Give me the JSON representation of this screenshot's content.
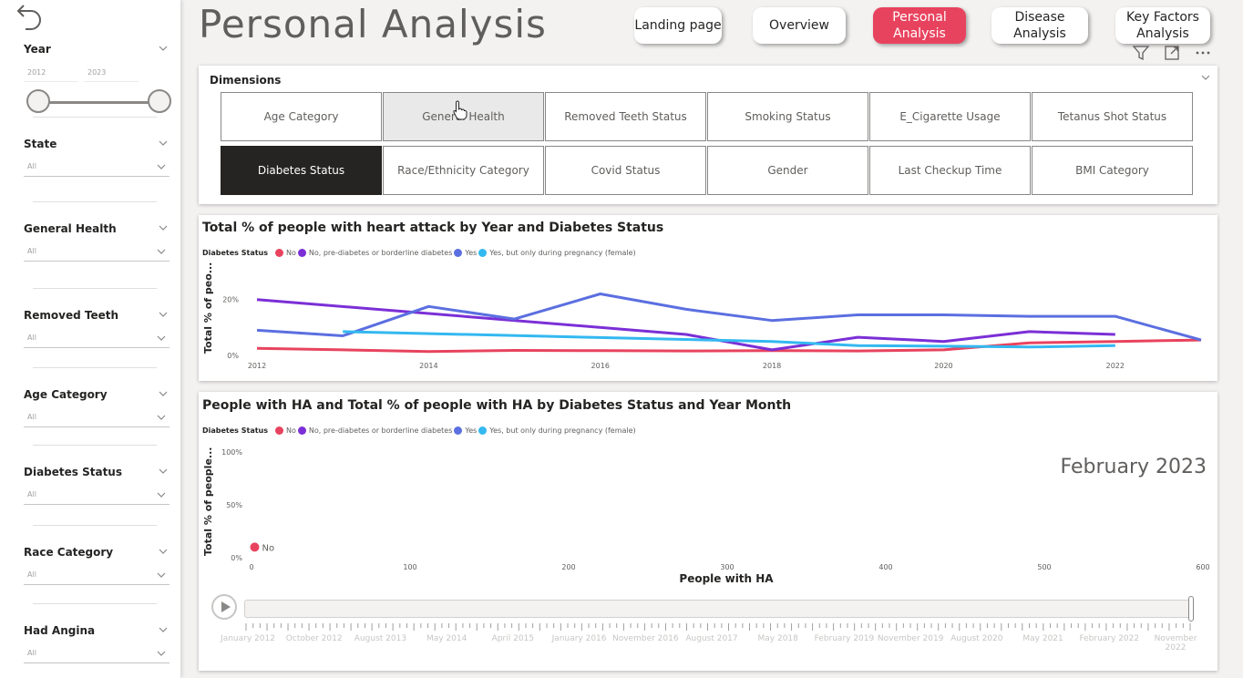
{
  "page": {
    "title": "Personal Analysis"
  },
  "nav": [
    {
      "label": "Landing page",
      "active": false
    },
    {
      "label": "Overview",
      "active": false
    },
    {
      "label": "Personal Analysis",
      "active": true
    },
    {
      "label": "Disease Analysis",
      "active": false
    },
    {
      "label": "Key Factors Analysis",
      "active": false
    }
  ],
  "toolbar_icons": [
    "filter-icon",
    "focus-mode-icon",
    "more-options-icon"
  ],
  "sidebar": {
    "back_icon": "back-arrow-icon",
    "year": {
      "title": "Year",
      "from": "2012",
      "to": "2023"
    },
    "filters": [
      {
        "title": "State",
        "value": "All"
      },
      {
        "title": "General Health",
        "value": "All"
      },
      {
        "title": "Removed Teeth",
        "value": "All"
      },
      {
        "title": "Age Category",
        "value": "All"
      },
      {
        "title": "Diabetes Status",
        "value": "All"
      },
      {
        "title": "Race Category",
        "value": "All"
      },
      {
        "title": "Had Angina",
        "value": "All"
      }
    ]
  },
  "dimensions": {
    "title": "Dimensions",
    "tiles": [
      {
        "label": "Age Category",
        "state": "normal"
      },
      {
        "label": "General Health",
        "state": "hover"
      },
      {
        "label": "Removed Teeth Status",
        "state": "normal"
      },
      {
        "label": "Smoking Status",
        "state": "normal"
      },
      {
        "label": "E_Cigarette Usage",
        "state": "normal"
      },
      {
        "label": "Tetanus Shot Status",
        "state": "normal"
      },
      {
        "label": "Diabetes Status",
        "state": "selected"
      },
      {
        "label": "Race/Ethnicity Category",
        "state": "normal"
      },
      {
        "label": "Covid Status",
        "state": "normal"
      },
      {
        "label": "Gender",
        "state": "normal"
      },
      {
        "label": "Last Checkup Time",
        "state": "normal"
      },
      {
        "label": "BMI Category",
        "state": "normal"
      }
    ]
  },
  "colors": {
    "No": "#e8435e",
    "No, pre-diabetes or borderline diabetes": "#7b2fd6",
    "Yes": "#5b6fe0",
    "Yes, but only during pregnancy (female)": "#33b8f0"
  },
  "chart1": {
    "title": "Total % of people with heart attack by Year and Diabetes Status",
    "legend_title": "Diabetes Status",
    "y_axis_title": "Total % of peo..."
  },
  "chart2": {
    "title": "People with HA and Total % of people with HA by Diabetes Status and Year Month",
    "legend_title": "Diabetes Status",
    "y_axis_title": "Total % of people...",
    "x_axis_title": "People with HA",
    "period_label": "February 2023",
    "point_label": "No"
  },
  "chart_data": [
    {
      "type": "line",
      "title": "Total % of people with heart attack by Year and Diabetes Status",
      "xlabel": "",
      "ylabel": "Total % of peo...",
      "x": [
        2012,
        2013,
        2014,
        2015,
        2016,
        2017,
        2018,
        2019,
        2020,
        2021,
        2022,
        2023
      ],
      "x_ticks": [
        "2012",
        "2014",
        "2016",
        "2018",
        "2020",
        "2022"
      ],
      "y_ticks": [
        "0%",
        "20%"
      ],
      "ylim": [
        0,
        0.3
      ],
      "legend": "top-left",
      "series": [
        {
          "name": "No",
          "values": [
            0.025,
            0.02,
            0.014,
            0.018,
            0.017,
            0.016,
            0.017,
            0.016,
            0.02,
            0.045,
            0.05,
            0.055
          ]
        },
        {
          "name": "No, pre-diabetes or borderline diabetes",
          "values": [
            0.2,
            null,
            null,
            null,
            null,
            0.075,
            0.02,
            0.065,
            0.05,
            0.085,
            0.075,
            null
          ]
        },
        {
          "name": "Yes",
          "values": [
            0.09,
            0.07,
            0.175,
            0.13,
            0.22,
            0.165,
            0.125,
            0.145,
            0.145,
            0.14,
            0.14,
            0.055
          ]
        },
        {
          "name": "Yes, but only during pregnancy (female)",
          "values": [
            null,
            0.085,
            null,
            null,
            null,
            null,
            0.05,
            0.035,
            0.033,
            0.03,
            0.035,
            null
          ]
        }
      ]
    },
    {
      "type": "scatter",
      "title": "People with HA and Total % of people with HA by Diabetes Status and Year Month",
      "xlabel": "People with HA",
      "ylabel": "Total % of people...",
      "xlim": [
        0,
        600
      ],
      "ylim": [
        0,
        1
      ],
      "x_ticks": [
        "0",
        "100",
        "200",
        "300",
        "400",
        "500",
        "600"
      ],
      "y_ticks": [
        "0%",
        "50%",
        "100%"
      ],
      "legend": "top-left",
      "series": [
        {
          "name": "No",
          "points": [
            {
              "x": 2,
              "y": 0.1
            }
          ]
        }
      ],
      "play_axis": [
        "January 2012",
        "October 2012",
        "August 2013",
        "May 2014",
        "April 2015",
        "January 2016",
        "November 2016",
        "August 2017",
        "May 2018",
        "February 2019",
        "November 2019",
        "August 2020",
        "May 2021",
        "February 2022",
        "November 2022"
      ],
      "current_period": "February 2023"
    }
  ]
}
